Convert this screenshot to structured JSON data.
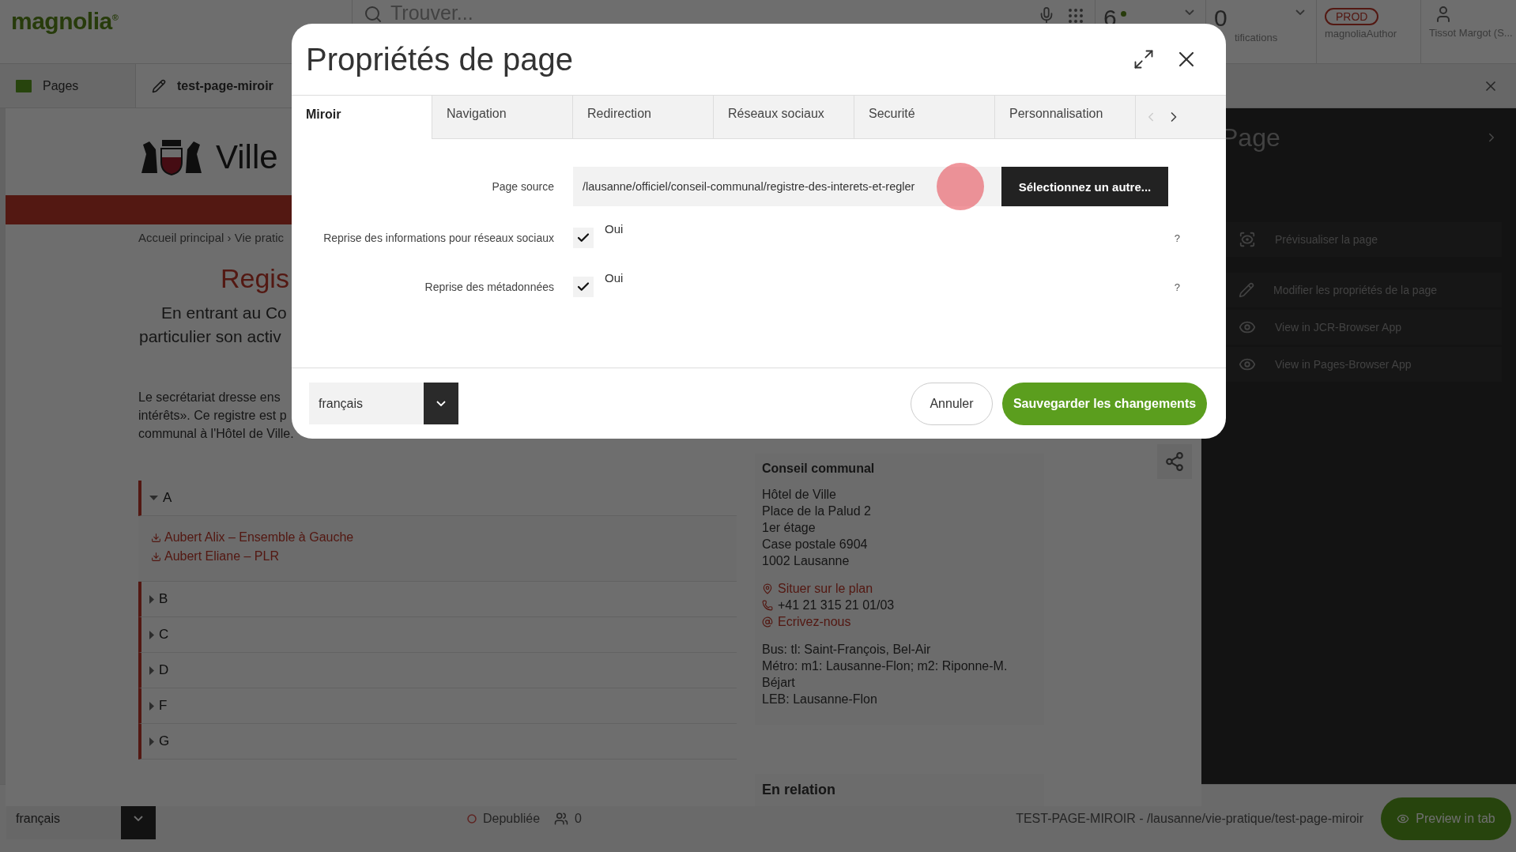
{
  "topbar": {
    "logo": "magnolia$^{®}$",
    "search_placeholder": "Trouver...",
    "tasks": {
      "count": "6"
    },
    "notifications": {
      "count": "0",
      "label": "tifications"
    },
    "environment": {
      "badge": "PROD",
      "instance": "magnoliaAuthor"
    },
    "user": {
      "name": "Tissot Margot (S..."
    }
  },
  "app_tabs": [
    {
      "label": "Pages",
      "selected": false,
      "kind": "app"
    },
    {
      "label": "test-page-miroir",
      "selected": true,
      "kind": "page"
    }
  ],
  "page": {
    "site_name": "Ville",
    "breadcrumb": "Accueil principal › Vie pratic",
    "heading": "Regis",
    "intro": [
      "En entrant au Co",
      "particulier son activ"
    ],
    "paragraph": [
      "Le secrétariat dresse ens",
      "intérêts». Ce registre est p",
      "communal à l'Hôtel de Ville."
    ],
    "accordion": [
      {
        "letter": "A",
        "expanded": true,
        "items": [
          "Aubert Alix – Ensemble à Gauche",
          "Aubert Eliane – PLR"
        ]
      },
      {
        "letter": "B",
        "expanded": false
      },
      {
        "letter": "C",
        "expanded": false
      },
      {
        "letter": "D",
        "expanded": false
      },
      {
        "letter": "F",
        "expanded": false
      },
      {
        "letter": "G",
        "expanded": false
      }
    ],
    "contact": {
      "title": "Conseil communal",
      "address": [
        "Hôtel de Ville",
        "Place de la Palud 2",
        "1er étage",
        "Case postale 6904",
        "1002 Lausanne"
      ],
      "links": [
        {
          "kind": "map",
          "text": "Situer sur le plan"
        },
        {
          "kind": "phone",
          "text": "+41 21 315 21 01/03"
        },
        {
          "kind": "email",
          "text": "Ecrivez-nous"
        }
      ],
      "transport": [
        "Bus: tl: Saint-François, Bel-Air",
        "Métro: m1: Lausanne-Flon; m2: Riponne-M.",
        "Béjart",
        "LEB: Lausanne-Flon"
      ]
    },
    "related": "En relation"
  },
  "side_panel": {
    "title": "Page",
    "actions": [
      {
        "kind": "preview",
        "label": "Prévisualiser la page"
      },
      {
        "kind": "edit",
        "label": "Modifier les propriétés de la page"
      },
      {
        "kind": "view",
        "label": "View in JCR-Browser App"
      },
      {
        "kind": "view",
        "label": "View in Pages-Browser App"
      }
    ]
  },
  "status_bar": {
    "language": "français",
    "status": "Depubliée",
    "collaborators": "0",
    "path": "TEST-PAGE-MIROIR - /lausanne/vie-pratique/test-page-miroir",
    "preview_button": "Preview in tab"
  },
  "dialog": {
    "title": "Propriétés de page",
    "tabs": [
      {
        "label": "Miroir",
        "selected": true
      },
      {
        "label": "Navigation",
        "selected": false
      },
      {
        "label": "Redirection",
        "selected": false
      },
      {
        "label": "Réseaux sociaux",
        "selected": false
      },
      {
        "label": "Securité",
        "selected": false
      },
      {
        "label": "Personnalisation",
        "selected": false
      }
    ],
    "fields": [
      {
        "kind": "link",
        "label": "Page source",
        "value": "/lausanne/officiel/conseil-communal/registre-des-interets-et-regler",
        "button": "Sélectionnez un autre..."
      },
      {
        "kind": "checkbox",
        "label": "Reprise des informations pour réseaux sociaux",
        "checked": true,
        "text": "Oui",
        "help": "?"
      },
      {
        "kind": "checkbox",
        "label": "Reprise des métadonnées",
        "checked": true,
        "text": "Oui",
        "help": "?"
      }
    ],
    "footer": {
      "language": "français",
      "cancel": "Annuler",
      "save": "Sauvegarder les changements"
    }
  }
}
